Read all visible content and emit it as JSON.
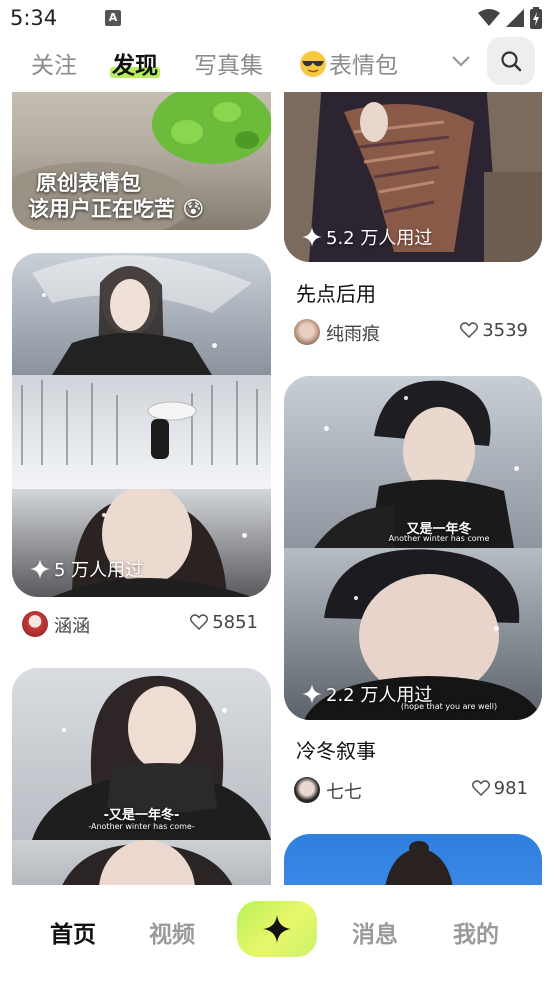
{
  "status_bar": {
    "time": "5:34",
    "notification_glyph": "A"
  },
  "top_tabs": {
    "items": [
      {
        "label": "关注"
      },
      {
        "label": "发现"
      },
      {
        "label": "写真集"
      },
      {
        "label": "表情包",
        "icon": "sunglasses-emoji-icon"
      }
    ],
    "active_index": 1,
    "more_icon": "chevron-down-icon",
    "search_icon": "search-icon"
  },
  "feed": {
    "cards": [
      {
        "overlay_line1": "原创表情包",
        "overlay_line2": "该用户正在吃苦",
        "overlay_emoji": "😰"
      },
      {
        "used": "5 万人用过",
        "author": "涵涵",
        "likes": "5851"
      },
      {
        "overlay_line1": "-又是一年冬-",
        "overlay_line2": "-Another winter has come-"
      },
      {
        "used": "5.2 万人用过",
        "title": "先点后用",
        "author": "纯雨痕",
        "likes": "3539"
      },
      {
        "used": "2.2 万人用过",
        "title": "冷冬叙事",
        "author": "七七",
        "likes": "981",
        "overlay_line1": "又是一年冬",
        "overlay_line2": "Another winter has come",
        "overlay_line3": "(hope that you are well)"
      }
    ]
  },
  "bottom_nav": {
    "items": [
      {
        "label": "首页"
      },
      {
        "label": "视频"
      },
      {
        "label": "消息"
      },
      {
        "label": "我的"
      }
    ],
    "active_index": 0,
    "create_icon": "sparkle-icon"
  },
  "colors": {
    "accent": "#b7f05a",
    "text": "#111111",
    "muted": "#8a8a8a"
  }
}
